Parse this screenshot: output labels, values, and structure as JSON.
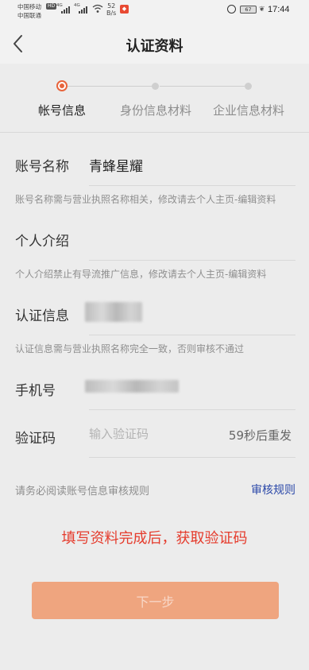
{
  "status_bar": {
    "carrier1": "中国移动",
    "carrier2": "中国联通",
    "hd": "HD",
    "gen1": "4G",
    "gen2": "4G",
    "speed_value": "52",
    "speed_unit": "B/s",
    "battery": "67",
    "time": "17:44"
  },
  "header": {
    "title": "认证资料",
    "back_icon": "chevron-left-icon"
  },
  "steps": [
    {
      "label": "帐号信息",
      "active": true
    },
    {
      "label": "身份信息材料",
      "active": false
    },
    {
      "label": "企业信息材料",
      "active": false
    }
  ],
  "form": {
    "account_name": {
      "label": "账号名称",
      "value": "青蜂星耀",
      "hint": "账号名称需与营业执照名称相关，修改请去个人主页-编辑资料"
    },
    "intro": {
      "label": "个人介绍",
      "hint": "个人介绍禁止有导流推广信息，修改请去个人主页-编辑资料"
    },
    "cert_info": {
      "label": "认证信息",
      "hint": "认证信息需与营业执照名称完全一致，否则审核不通过"
    },
    "phone": {
      "label": "手机号"
    },
    "code": {
      "label": "验证码",
      "placeholder": "输入验证码",
      "resend": "59秒后重发"
    }
  },
  "notice": {
    "text": "请务必阅读账号信息审核规则",
    "link": "审核规则"
  },
  "annotation": "填写资料完成后，获取验证码",
  "next_button": "下一步",
  "colors": {
    "accent": "#e8643c",
    "button": "#efa57f",
    "link": "#2a47a8",
    "annotation": "#e53b2c"
  }
}
